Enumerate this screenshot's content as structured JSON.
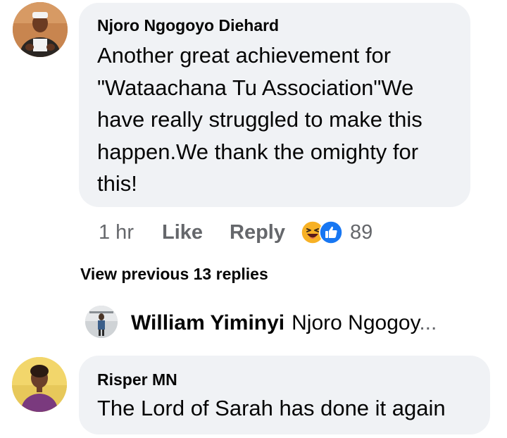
{
  "comment_1": {
    "author": "Njoro Ngogoyo Diehard",
    "text": "Another great achievement for \"Wataachana Tu Association\"We have really struggled to make this happen.We thank the omighty for this!",
    "time": "1 hr",
    "like_label": "Like",
    "reply_label": "Reply",
    "reactions": [
      "haha-icon",
      "like-icon"
    ],
    "reaction_count": "89",
    "colors": {
      "like": "#1877f2",
      "haha": "#f7b125"
    }
  },
  "view_previous": "View previous 13 replies",
  "reply_preview": {
    "author": "William Yiminyi",
    "text": "Njoro Ngogoy",
    "ellipsis": "..."
  },
  "comment_2": {
    "author": "Risper MN",
    "text": "The Lord of Sarah has done it again"
  },
  "colors": {
    "bubble": "#f0f2f5",
    "secondary_text": "#65676b",
    "primary_text": "#050505"
  }
}
